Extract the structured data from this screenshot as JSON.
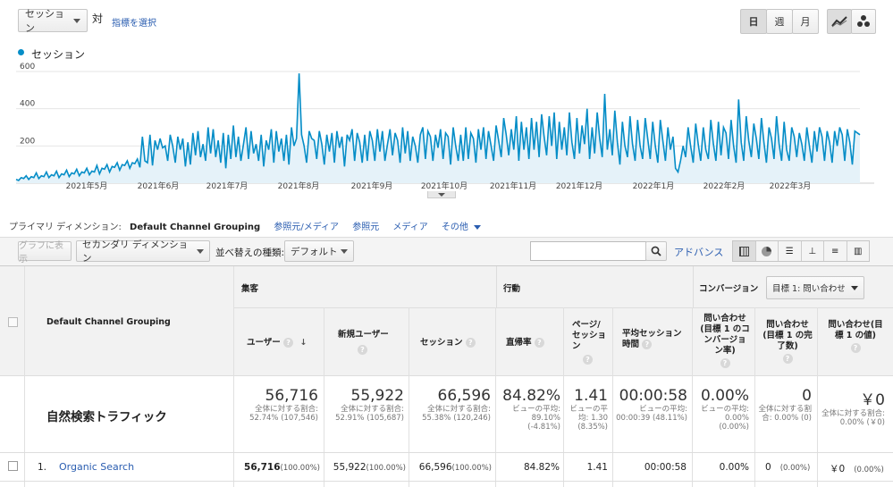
{
  "top": {
    "metric_select": "セッション",
    "vs": "対",
    "select_metric_link": "指標を選択",
    "period_buttons": [
      "日",
      "週",
      "月"
    ],
    "legend": "セッション",
    "accent": "#058dc7"
  },
  "chart_data": {
    "type": "area",
    "series": [
      {
        "name": "セッション",
        "values": [
          20,
          15,
          30,
          25,
          40,
          20,
          35,
          30,
          55,
          25,
          40,
          35,
          60,
          30,
          45,
          40,
          65,
          30,
          50,
          45,
          70,
          35,
          55,
          50,
          75,
          40,
          60,
          55,
          80,
          45,
          65,
          60,
          95,
          50,
          80,
          75,
          100,
          60,
          90,
          85,
          110,
          70,
          100,
          95,
          120,
          80,
          110,
          105,
          130,
          85,
          250,
          120,
          110,
          260,
          95,
          230,
          180,
          240,
          190,
          200,
          120,
          260,
          200,
          110,
          250,
          180,
          240,
          90,
          220,
          100,
          270,
          150,
          280,
          140,
          210,
          120,
          300,
          160,
          290,
          140,
          230,
          110,
          270,
          80,
          260,
          130,
          310,
          140,
          250,
          120,
          210,
          300,
          130,
          280,
          160,
          210,
          120,
          260,
          90,
          230,
          180,
          290,
          110,
          280,
          170,
          240,
          120,
          260,
          100,
          300,
          200,
          240,
          590,
          260,
          200,
          110,
          280,
          240,
          230,
          130,
          280,
          210,
          100,
          260,
          170,
          270,
          110,
          280,
          190,
          250,
          90,
          260,
          230,
          290,
          120,
          270,
          220,
          110,
          260,
          120,
          280,
          230,
          120,
          290,
          170,
          280,
          120,
          210,
          290,
          150,
          270,
          230,
          110,
          300,
          160,
          280,
          120,
          250,
          200,
          110,
          260,
          300,
          130,
          280,
          250,
          120,
          260,
          190,
          290,
          130,
          270,
          250,
          100,
          300,
          200,
          120,
          260,
          120,
          300,
          130,
          270,
          240,
          110,
          290,
          180,
          300,
          130,
          280,
          200,
          120,
          310,
          230,
          140,
          350,
          260,
          150,
          290,
          180,
          360,
          120,
          330,
          180,
          300,
          130,
          350,
          180,
          330,
          140,
          370,
          250,
          150,
          360,
          200,
          380,
          130,
          330,
          180,
          300,
          150,
          380,
          220,
          130,
          350,
          160,
          310,
          210,
          400,
          130,
          300,
          160,
          380,
          240,
          140,
          480,
          180,
          290,
          150,
          390,
          220,
          100,
          330,
          200,
          140,
          360,
          210,
          120,
          340,
          200,
          130,
          350,
          240,
          130,
          330,
          200,
          110,
          340,
          230,
          120,
          300,
          180,
          250,
          80,
          60,
          120,
          200,
          140,
          300,
          200,
          110,
          320,
          210,
          120,
          300,
          180,
          130,
          340,
          210,
          120,
          330,
          150,
          300,
          270,
          130,
          340,
          200,
          110,
          450,
          220,
          120,
          360,
          230,
          140,
          320,
          240,
          130,
          350,
          220,
          110,
          300,
          240,
          130,
          360,
          210,
          120,
          330,
          180,
          120,
          300,
          250,
          140,
          270,
          210,
          120,
          300,
          200,
          110,
          280,
          170,
          300,
          250,
          120,
          280,
          220,
          110,
          280,
          200,
          300,
          260,
          120,
          290,
          220,
          100,
          280,
          270,
          260
        ]
      }
    ],
    "ylim": [
      0,
      600
    ],
    "y_ticks": [
      "600",
      "400",
      "200"
    ],
    "x_ticks": [
      "2021年5月",
      "2021年6月",
      "2021年7月",
      "2021年8月",
      "2021年9月",
      "2021年10月",
      "2021年11月",
      "2021年12月",
      "2022年1月",
      "2022年2月",
      "2022年3月"
    ],
    "grid": true
  },
  "dimension_bar": {
    "label": "プライマリ ディメンション:",
    "active": "Default Channel Grouping",
    "items": [
      "参照元/メディア",
      "参照元",
      "メディア",
      "その他"
    ]
  },
  "toolbar": {
    "graph_button": "グラフに表示",
    "secondary_dim": "セカンダリ ディメンション",
    "sort_label": "並べ替えの種類:",
    "sort_value": "デフォルト",
    "search_placeholder": "",
    "advanced": "アドバンス"
  },
  "table": {
    "dim_header": "Default Channel Grouping",
    "groups": {
      "acquisition": "集客",
      "behavior": "行動",
      "conversion": "コンバージョン"
    },
    "goal_select": "目標 1: 問い合わせ",
    "columns": [
      "ユーザー",
      "新規ユーザー",
      "セッション",
      "直帰率",
      "ページ/セッション",
      "平均セッション時間",
      "問い合わせ(目標 1 のコンバージョン率)",
      "問い合わせ(目標 1 の完了数)",
      "問い合わせ(目標 1 の値)"
    ],
    "segment_name": "自然検索トラフィック",
    "totals": [
      {
        "value": "56,716",
        "sub": "全体に対する割合: 52.74% (107,546)"
      },
      {
        "value": "55,922",
        "sub": "全体に対する割合: 52.91% (105,687)"
      },
      {
        "value": "66,596",
        "sub": "全体に対する割合: 55.38% (120,246)"
      },
      {
        "value": "84.82%",
        "sub": "ビューの平均: 89.10% (-4.81%)"
      },
      {
        "value": "1.41",
        "sub": "ビューの平均: 1.30 (8.35%)"
      },
      {
        "value": "00:00:58",
        "sub": "ビューの平均: 00:00:39 (48.11%)"
      },
      {
        "value": "0.00%",
        "sub": "ビューの平均: 0.00% (0.00%)"
      },
      {
        "value": "0",
        "sub": "全体に対する割合: 0.00% (0)"
      },
      {
        "value": "￥0",
        "sub": "全体に対する割合: 0.00% (￥0)"
      }
    ],
    "rows": [
      {
        "index": "1.",
        "name": "Organic Search",
        "cells": [
          "56,716",
          "(100.00%)",
          "55,922",
          "(100.00%)",
          "66,596",
          "(100.00%)",
          "84.82%",
          "1.41",
          "00:00:58",
          "0.00%",
          "0",
          "(0.00%)",
          "￥0",
          "(0.00%)"
        ]
      }
    ]
  }
}
